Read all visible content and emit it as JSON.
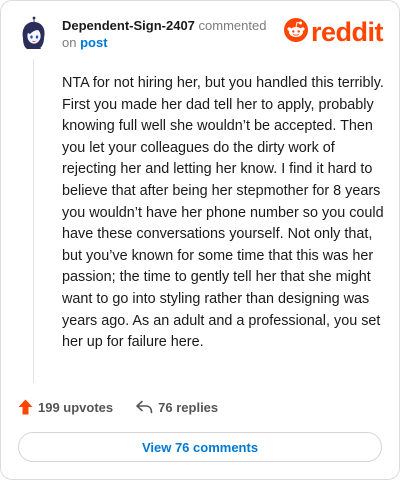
{
  "header": {
    "username": "Dependent-Sign-2407",
    "action_text": "commented on",
    "post_link_text": "post"
  },
  "brand": {
    "logo_text": "reddit",
    "accent_color": "#ff4500",
    "logo_icon": "reddit-snoo-icon"
  },
  "comment": {
    "body": "NTA for not hiring her, but you handled this terribly. First you made her dad tell her to apply, probably knowing full well she wouldn’t be accepted. Then you let your colleagues do the dirty work of rejecting her and letting her know. I find it hard to believe that after being her stepmother for 8 years you wouldn’t have her phone number so you could have these conversations yourself. Not only that, but you’ve known for some time that this was her passion; the time to gently tell her that she might want to go into styling rather than designing was years ago. As an adult and a professional, you set her up for failure here."
  },
  "stats": {
    "upvotes_label": "199 upvotes",
    "upvote_icon": "upvote-arrow-icon",
    "replies_label": "76 replies",
    "reply_icon": "reply-arrow-icon"
  },
  "actions": {
    "view_comments_label": "View 76 comments"
  },
  "colors": {
    "link_blue": "#0079d3",
    "text_dark": "#1a1a1b",
    "muted": "#7c7c7c"
  }
}
